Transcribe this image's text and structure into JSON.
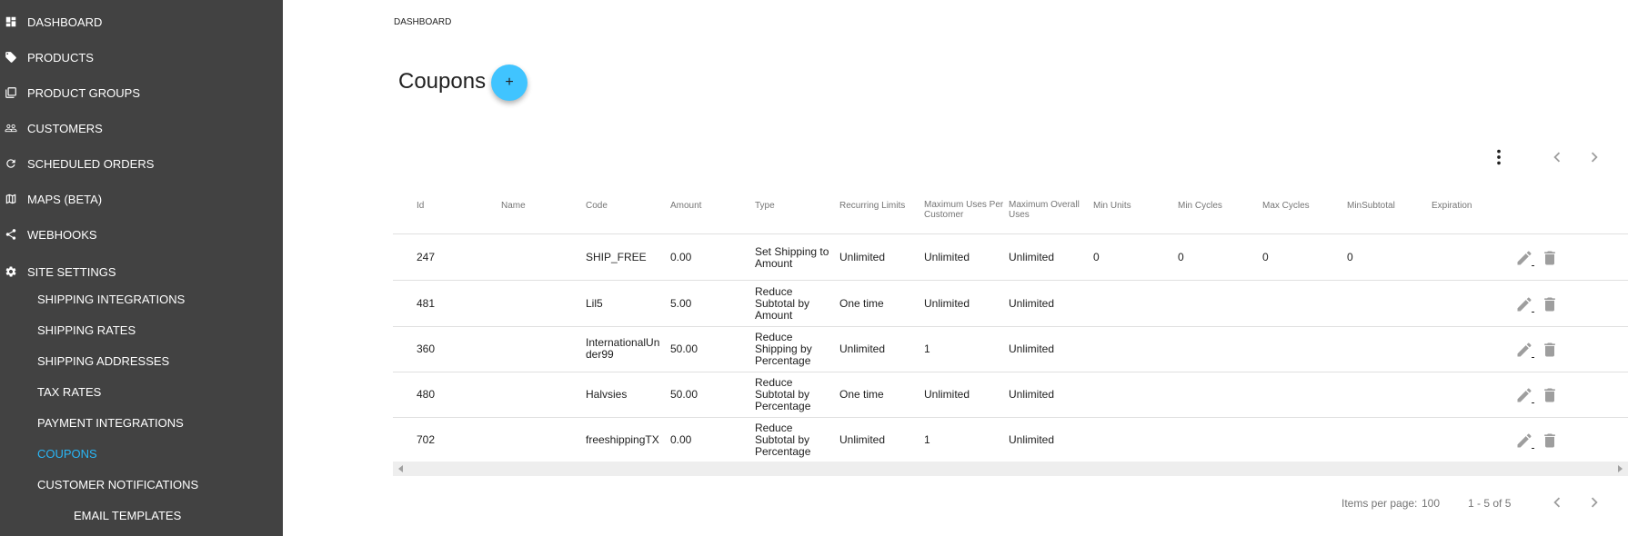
{
  "sidebar": {
    "items": [
      {
        "label": "DASHBOARD",
        "icon": "dashboard-icon"
      },
      {
        "label": "PRODUCTS",
        "icon": "tag-icon"
      },
      {
        "label": "PRODUCT GROUPS",
        "icon": "library-icon"
      },
      {
        "label": "CUSTOMERS",
        "icon": "people-icon"
      },
      {
        "label": "SCHEDULED ORDERS",
        "icon": "refresh-icon"
      },
      {
        "label": "MAPS (BETA)",
        "icon": "map-icon"
      },
      {
        "label": "WEBHOOKS",
        "icon": "share-icon"
      },
      {
        "label": "SITE SETTINGS",
        "icon": "gear-icon"
      }
    ],
    "site_settings_items": [
      {
        "label": "SHIPPING INTEGRATIONS"
      },
      {
        "label": "SHIPPING RATES"
      },
      {
        "label": "SHIPPING ADDRESSES"
      },
      {
        "label": "TAX RATES"
      },
      {
        "label": "PAYMENT INTEGRATIONS"
      },
      {
        "label": "COUPONS"
      },
      {
        "label": "CUSTOMER NOTIFICATIONS"
      }
    ],
    "notification_items": [
      {
        "label": "EMAIL TEMPLATES"
      }
    ],
    "active_color": "#29b6f6",
    "background": "#424242"
  },
  "main": {
    "breadcrumb": "DASHBOARD",
    "title": "Coupons",
    "add_label": "+",
    "fab_color": "#40c4ff"
  },
  "table": {
    "columns": [
      "Id",
      "Name",
      "Code",
      "Amount",
      "Type",
      "Recurring Limits",
      "Maximum Uses Per Customer",
      "Maximum Overall Uses",
      "Min Units",
      "Min Cycles",
      "Max Cycles",
      "MinSubtotal",
      "Expiration"
    ],
    "rows": [
      {
        "id": "247",
        "name": "",
        "code": "SHIP_FREE",
        "amount": "0.00",
        "type": "Set Shipping to Amount",
        "recurring": "Unlimited",
        "max_per_customer": "Unlimited",
        "max_overall": "Unlimited",
        "min_units": "0",
        "min_cycles": "0",
        "max_cycles": "0",
        "min_subtotal": "0",
        "expiration": ""
      },
      {
        "id": "481",
        "name": "",
        "code": "Lil5",
        "amount": "5.00",
        "type": "Reduce Subtotal by Amount",
        "recurring": "One time",
        "max_per_customer": "Unlimited",
        "max_overall": "Unlimited",
        "min_units": "",
        "min_cycles": "",
        "max_cycles": "",
        "min_subtotal": "",
        "expiration": ""
      },
      {
        "id": "360",
        "name": "",
        "code": "InternationalUnder99",
        "amount": "50.00",
        "type": "Reduce Shipping by Percentage",
        "recurring": "Unlimited",
        "max_per_customer": "1",
        "max_overall": "Unlimited",
        "min_units": "",
        "min_cycles": "",
        "max_cycles": "",
        "min_subtotal": "",
        "expiration": ""
      },
      {
        "id": "480",
        "name": "",
        "code": "Halvsies",
        "amount": "50.00",
        "type": "Reduce Subtotal by Percentage",
        "recurring": "One time",
        "max_per_customer": "Unlimited",
        "max_overall": "Unlimited",
        "min_units": "",
        "min_cycles": "",
        "max_cycles": "",
        "min_subtotal": "",
        "expiration": ""
      },
      {
        "id": "702",
        "name": "",
        "code": "freeshippingTX",
        "amount": "0.00",
        "type": "Reduce Subtotal by Percentage",
        "recurring": "Unlimited",
        "max_per_customer": "1",
        "max_overall": "Unlimited",
        "min_units": "",
        "min_cycles": "",
        "max_cycles": "",
        "min_subtotal": "",
        "expiration": ""
      }
    ]
  },
  "paginator": {
    "items_per_page_label": "Items per page:",
    "items_per_page": "100",
    "range_label": "1 - 5 of 5"
  }
}
